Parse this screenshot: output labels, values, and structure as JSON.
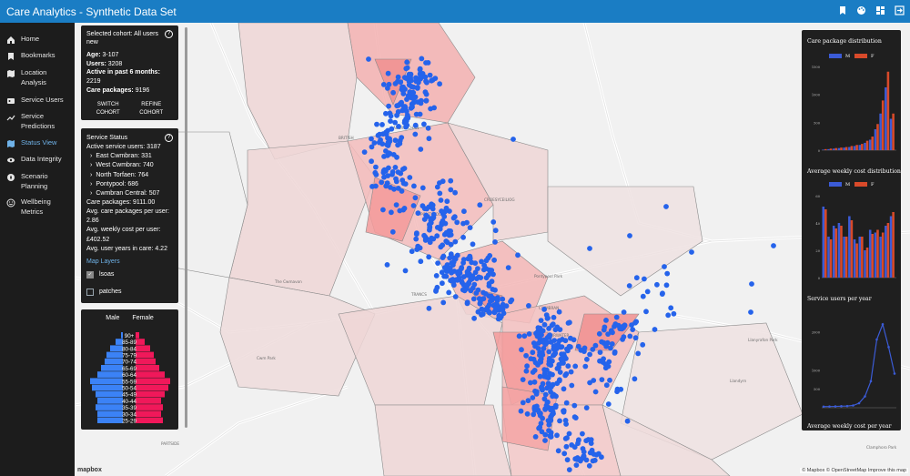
{
  "app": {
    "title": "Care Analytics - Synthetic Data Set"
  },
  "colors": {
    "topbar": "#1a7dc4",
    "accent": "#6fb2e8",
    "point": "#2563eb",
    "male": "#3b82f6",
    "female": "#f0185a",
    "polygon_high": "#f3a7a7",
    "polygon_low": "#efd6d6"
  },
  "topbar_icons": [
    "bookmark-icon",
    "palette-icon",
    "dashboard-icon",
    "exit-icon"
  ],
  "sidebar": {
    "items": [
      {
        "label": "Home",
        "icon": "home-icon",
        "active": false
      },
      {
        "label": "Bookmarks",
        "icon": "bookmark-icon",
        "active": false
      },
      {
        "label": "Location Analysis",
        "icon": "map-icon",
        "active": false
      },
      {
        "label": "Service Users",
        "icon": "id-card-icon",
        "active": false
      },
      {
        "label": "Service Predictions",
        "icon": "trend-icon",
        "active": false
      },
      {
        "label": "Status View",
        "icon": "map-icon",
        "active": true
      },
      {
        "label": "Data Integrity",
        "icon": "eye-icon",
        "active": false
      },
      {
        "label": "Scenario Planning",
        "icon": "compass-icon",
        "active": false
      },
      {
        "label": "Wellbeing Metrics",
        "icon": "smile-icon",
        "active": false
      }
    ]
  },
  "cohort": {
    "title": "Selected cohort: All users new",
    "age_label": "Age:",
    "age_value": "3-107",
    "users_label": "Users:",
    "users_value": "3208",
    "active_label": "Active in past 6 months:",
    "active_value": "2219",
    "packages_label": "Care packages:",
    "packages_value": "9196",
    "switch_label": "SWITCH COHORT",
    "refine_label": "REFINE COHORT"
  },
  "status": {
    "title": "Service Status",
    "active_users": "Active service users: 3187",
    "regions": [
      "East Cwmbran: 331",
      "West Cwmbran: 740",
      "North Torfaen: 764",
      "Pontypool: 686",
      "Cwmbran Central: 507"
    ],
    "care_packages": "Care packages: 9111.00",
    "avg_packages": "Avg. care packages per user: 2.86",
    "avg_cost": "Avg. weekly cost per user: £402.52",
    "avg_years": "Avg. user years in care: 4.22",
    "layers_title": "Map Layers",
    "layers": [
      {
        "label": "lsoas",
        "checked": true
      },
      {
        "label": "patches",
        "checked": false
      }
    ]
  },
  "pyramid": {
    "male_label": "Male",
    "female_label": "Female",
    "groups": [
      "90+",
      "85-89",
      "80-84",
      "75-79",
      "70-74",
      "65-69",
      "60-64",
      "55-59",
      "50-54",
      "45-49",
      "40-44",
      "35-39",
      "30-34",
      "25-29",
      "20-24"
    ],
    "male": [
      2,
      8,
      14,
      18,
      20,
      24,
      28,
      36,
      34,
      30,
      28,
      30,
      28,
      28,
      26
    ],
    "female": [
      4,
      10,
      16,
      20,
      22,
      26,
      32,
      38,
      36,
      32,
      28,
      30,
      28,
      30,
      28
    ]
  },
  "right_charts": {
    "titles": [
      "Care package distribution",
      "Average weekly cost distribution",
      "Service users per year",
      "Average weekly cost per year"
    ],
    "legend_m": "M",
    "legend_f": "F",
    "care_yticks": [
      "1500",
      "1000",
      "500",
      "0"
    ],
    "cost_yticks": [
      "60",
      "40",
      "20",
      "0"
    ],
    "users_yticks": [
      "2000",
      "1000",
      "500"
    ],
    "care_m": [
      1,
      2,
      3,
      4,
      5,
      6,
      8,
      10,
      14,
      20,
      40,
      70,
      120,
      60
    ],
    "care_f": [
      2,
      3,
      4,
      5,
      6,
      8,
      10,
      12,
      18,
      26,
      50,
      95,
      150,
      70
    ],
    "cost_m": [
      52,
      30,
      38,
      40,
      30,
      45,
      28,
      30,
      20,
      35,
      33,
      30,
      38,
      45
    ],
    "cost_f": [
      50,
      28,
      36,
      38,
      30,
      42,
      25,
      30,
      22,
      32,
      35,
      33,
      40,
      48
    ],
    "users_series": [
      30,
      32,
      35,
      40,
      45,
      60,
      120,
      300,
      700,
      1800,
      2200,
      1600,
      900
    ]
  },
  "map": {
    "places": [
      "BRITISH",
      "ABERSYCHAN",
      "PONTYPOOL",
      "TRANCS",
      "Pontypool Park",
      "The Cwmavon",
      "CWMBRAN",
      "Llanyrafon Park",
      "CROESYCEILIOG",
      "FAIRWATER",
      "PARTSIDE",
      "Cwm Park",
      "Llandyrn",
      "Clamphoro Park"
    ],
    "logo": "mapbox",
    "attribution": "© Mapbox © OpenStreetMap Improve this map"
  }
}
